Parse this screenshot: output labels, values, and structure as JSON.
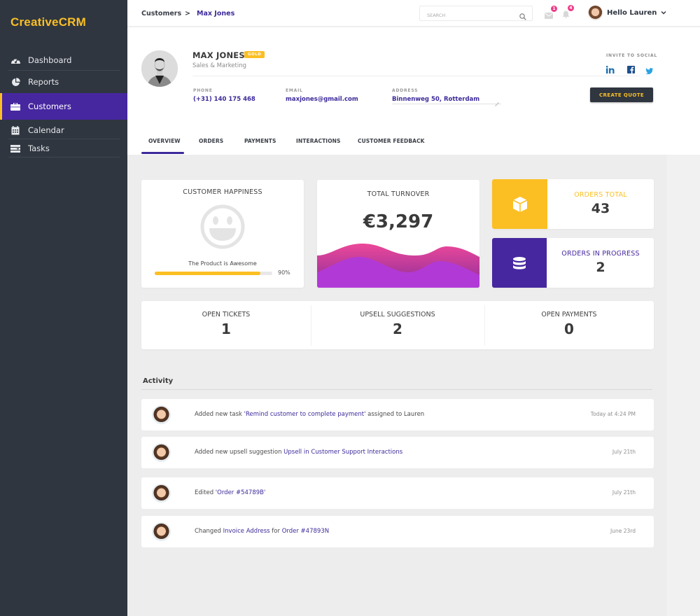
{
  "app": {
    "logo": "CreativeCRM"
  },
  "sidebar": {
    "items": [
      {
        "label": "Dashboard",
        "icon": "dashboard-gauge-icon",
        "active": false
      },
      {
        "label": "Reports",
        "icon": "pie-chart-icon",
        "active": false
      },
      {
        "label": "Customers",
        "icon": "briefcase-icon",
        "active": true
      },
      {
        "label": "Calendar",
        "icon": "calendar-icon",
        "active": false
      },
      {
        "label": "Tasks",
        "icon": "tasks-list-icon",
        "active": false
      }
    ]
  },
  "header": {
    "breadcrumb": {
      "parent": "Customers",
      "separator": ">",
      "current": "Max Jones"
    },
    "search": {
      "placeholder": "SEARCH",
      "value": ""
    },
    "messages_badge": "1",
    "notifications_badge": "4",
    "greeting": "Hello Lauren"
  },
  "profile": {
    "name": "MAX JONES",
    "tier_badge": "GOLD",
    "role": "Sales & Marketing",
    "fields": [
      {
        "label": "PHONE",
        "value": "(+31) 140 175 468"
      },
      {
        "label": "EMAIL",
        "value": "maxjones@gmail.com"
      },
      {
        "label": "ADDRESS",
        "value": "Binnenweg 50, Rotterdam"
      }
    ],
    "social": {
      "label": "INVITE TO SOCIAL",
      "networks": [
        "LinkedIn",
        "Facebook",
        "Twitter"
      ]
    },
    "create_quote_label": "CREATE QUOTE"
  },
  "tabs": [
    {
      "label": "OVERVIEW",
      "active": true
    },
    {
      "label": "ORDERS",
      "active": false
    },
    {
      "label": "PAYMENTS",
      "active": false
    },
    {
      "label": "INTERACTIONS",
      "active": false
    },
    {
      "label": "CUSTOMER FEEDBACK",
      "active": false
    }
  ],
  "cards": {
    "happiness": {
      "title": "CUSTOMER HAPPINESS",
      "caption": "The Product is Awesome",
      "percent": 90,
      "percent_label": "90%"
    },
    "turnover": {
      "title": "TOTAL TURNOVER",
      "value": "€3,297"
    },
    "orders_total": {
      "label": "ORDERS TOTAL",
      "value": "43",
      "color": "#fbbf24"
    },
    "orders_in_progress": {
      "label": "ORDERS IN PROGRESS",
      "value": "2",
      "color": "#46279f"
    },
    "counts": [
      {
        "label": "OPEN TICKETS",
        "value": "1"
      },
      {
        "label": "UPSELL SUGGESTIONS",
        "value": "2"
      },
      {
        "label": "OPEN PAYMENTS",
        "value": "0"
      }
    ]
  },
  "activity": {
    "title": "Activity",
    "items": [
      {
        "parts": [
          {
            "t": "Added new task ",
            "link": false
          },
          {
            "t": "'Remind customer to complete payment'",
            "link": true
          },
          {
            "t": " assigned to Lauren",
            "link": false
          }
        ],
        "time": "Today at 4:24 PM"
      },
      {
        "parts": [
          {
            "t": "Added new upsell suggestion ",
            "link": false
          },
          {
            "t": "Upsell in Customer Support Interactions",
            "link": true
          }
        ],
        "time": "July 21th"
      },
      {
        "parts": [
          {
            "t": "Edited ",
            "link": false
          },
          {
            "t": "'Order #54789B'",
            "link": true
          }
        ],
        "time": "July 21th"
      },
      {
        "parts": [
          {
            "t": "Changed ",
            "link": false
          },
          {
            "t": "Invoice Address",
            "link": true
          },
          {
            "t": " for ",
            "link": false
          },
          {
            "t": "Order #47893N",
            "link": true
          }
        ],
        "time": "June 23rd"
      }
    ]
  },
  "colors": {
    "primary": "#46279f",
    "accent": "#fbbf24",
    "sidebar": "#2f3640",
    "link": "#3d2a9a",
    "badge": "#ec3d86"
  }
}
